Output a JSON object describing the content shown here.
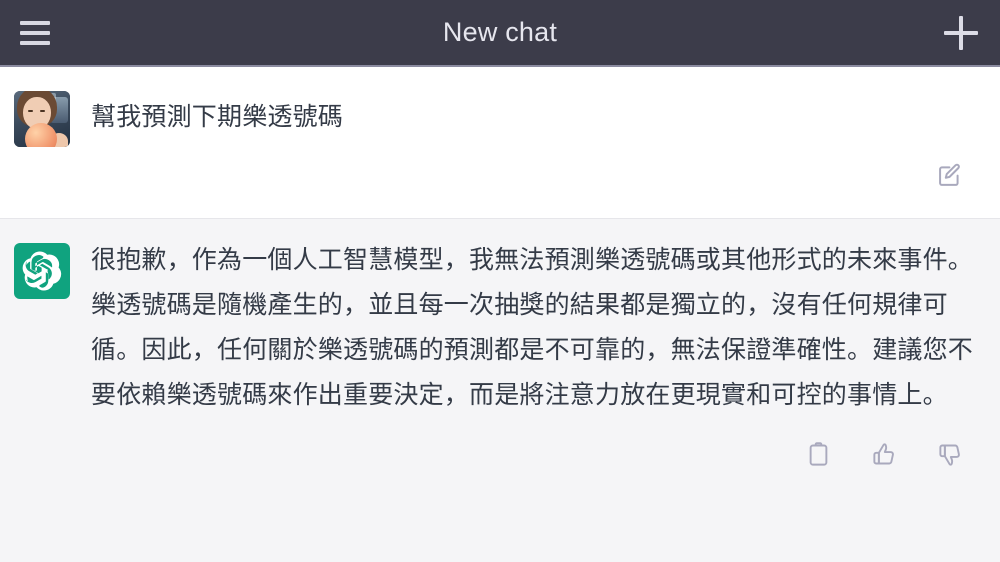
{
  "header": {
    "title": "New chat",
    "menu_icon": "hamburger-menu-icon",
    "new_chat_icon": "plus-icon",
    "background_color": "#3c3c4a",
    "title_color": "#e6e6ee"
  },
  "messages": [
    {
      "role": "user",
      "avatar_type": "user-photo",
      "text": "幫我預測下期樂透號碼",
      "background_color": "#ffffff",
      "actions": [
        {
          "name": "edit-message-button",
          "icon": "edit-pencil-square-icon"
        }
      ]
    },
    {
      "role": "assistant",
      "avatar_type": "chatgpt-logo",
      "avatar_color": "#10a37f",
      "text": "很抱歉，作為一個人工智慧模型，我無法預測樂透號碼或其他形式的未來事件。樂透號碼是隨機產生的，並且每一次抽獎的結果都是獨立的，沒有任何規律可循。因此，任何關於樂透號碼的預測都是不可靠的，無法保證準確性。建議您不要依賴樂透號碼來作出重要決定，而是將注意力放在更現實和可控的事情上。",
      "background_color": "#f5f5f7",
      "actions": [
        {
          "name": "copy-button",
          "icon": "clipboard-icon"
        },
        {
          "name": "thumbs-up-button",
          "icon": "thumbs-up-icon"
        },
        {
          "name": "thumbs-down-button",
          "icon": "thumbs-down-icon"
        }
      ]
    }
  ],
  "colors": {
    "text_primary": "#343b47",
    "icon_muted": "#a9a9bd",
    "divider": "#e6e6ea"
  }
}
